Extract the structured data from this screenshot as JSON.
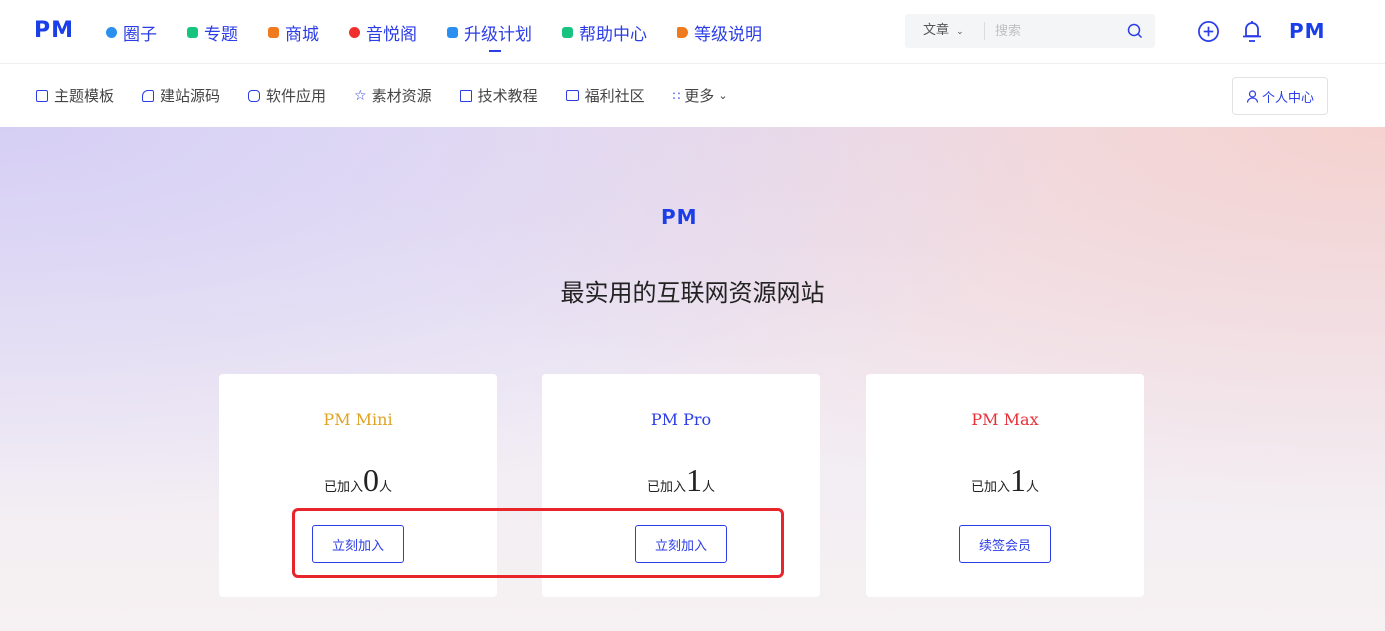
{
  "header": {
    "logo": "PM",
    "nav": [
      {
        "label": "圈子",
        "icon": "circle-icon",
        "color": "#2b8ff0"
      },
      {
        "label": "专题",
        "icon": "topic-icon",
        "color": "#16c47f"
      },
      {
        "label": "商城",
        "icon": "shop-icon",
        "color": "#f07a1e"
      },
      {
        "label": "音悦阁",
        "icon": "music-icon",
        "color": "#f0302e"
      },
      {
        "label": "升级计划",
        "icon": "upgrade-icon",
        "color": "#2b8ff0"
      },
      {
        "label": "帮助中心",
        "icon": "help-icon",
        "color": "#16c47f"
      },
      {
        "label": "等级说明",
        "icon": "level-icon",
        "color": "#f07a1e"
      }
    ],
    "active_nav": "升级计划",
    "search": {
      "category": "文章",
      "placeholder": "搜索"
    },
    "right_logo": "PM"
  },
  "subnav": {
    "items": [
      {
        "label": "主题模板",
        "icon": "theme-icon"
      },
      {
        "label": "建站源码",
        "icon": "source-icon"
      },
      {
        "label": "软件应用",
        "icon": "software-icon"
      },
      {
        "label": "素材资源",
        "icon": "star-icon"
      },
      {
        "label": "技术教程",
        "icon": "tutorial-icon"
      },
      {
        "label": "福利社区",
        "icon": "image-icon"
      },
      {
        "label": "更多",
        "icon": "grid-icon"
      }
    ],
    "user_center": "个人中心"
  },
  "hero": {
    "logo": "PM",
    "title": "最实用的互联网资源网站"
  },
  "plans": [
    {
      "name": "PM Mini",
      "color": "#e0a326",
      "prefix": "已加入",
      "count": "0",
      "suffix": "人",
      "button": "立刻加入"
    },
    {
      "name": "PM Pro",
      "color": "#2b3de6",
      "prefix": "已加入",
      "count": "1",
      "suffix": "人",
      "button": "立刻加入"
    },
    {
      "name": "PM Max",
      "color": "#e8303a",
      "prefix": "已加入",
      "count": "1",
      "suffix": "人",
      "button": "续签会员"
    }
  ],
  "colors": {
    "brand": "#1a3ee8",
    "accent": "#2b3de6",
    "highlight": "#e8252b"
  }
}
